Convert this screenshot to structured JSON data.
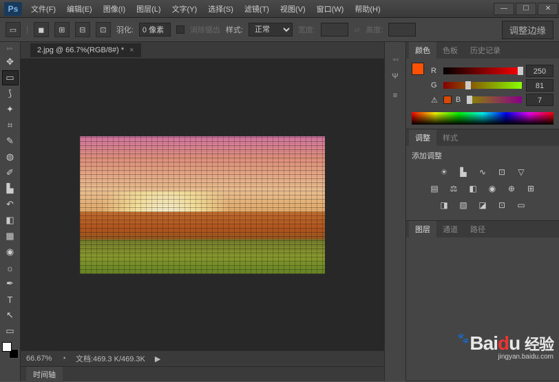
{
  "menu": {
    "items": [
      "文件(F)",
      "编辑(E)",
      "图像(I)",
      "图层(L)",
      "文字(Y)",
      "选择(S)",
      "滤镜(T)",
      "视图(V)",
      "窗口(W)",
      "帮助(H)"
    ]
  },
  "options": {
    "feather_label": "羽化:",
    "feather_value": "0 像素",
    "antialias": "消除锯齿",
    "style_label": "样式:",
    "style_value": "正常",
    "width_label": "宽度:",
    "height_label": "高度:",
    "refine_edge": "调整边缘"
  },
  "document": {
    "tab_title": "2.jpg @ 66.7%(RGB/8#) *"
  },
  "status": {
    "zoom": "66.67%",
    "doc_info": "文档:469.3 K/469.3K"
  },
  "timeline": {
    "label": "时间轴"
  },
  "panels": {
    "color": {
      "tabs": [
        "颜色",
        "色板",
        "历史记录"
      ],
      "r_label": "R",
      "r_value": "250",
      "g_label": "G",
      "g_value": "81",
      "b_label": "B",
      "b_value": "7",
      "fg_color": "#fa5107",
      "bg_color": "#d84800"
    },
    "adjust": {
      "tabs": [
        "调整",
        "样式"
      ],
      "add_label": "添加调整"
    },
    "layers": {
      "tabs": [
        "图层",
        "通道",
        "路径"
      ]
    }
  },
  "watermark": {
    "brand_pre": "Bai",
    "brand_o": "d",
    "brand_post": "u",
    "brand_cn": "经验",
    "url": "jingyan.baidu.com"
  }
}
